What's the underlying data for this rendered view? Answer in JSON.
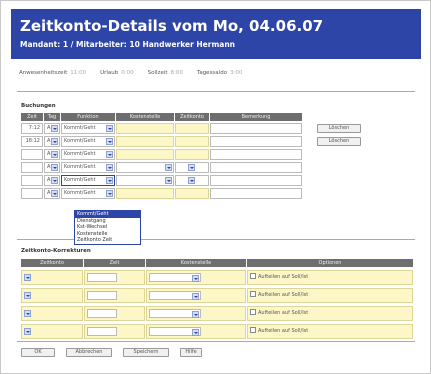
{
  "header": {
    "title": "Zeitkonto-Details vom Mo, 04.06.07",
    "subtitle": "Mandant: 1 / Mitarbeiter: 10 Handwerker Hermann"
  },
  "summary": {
    "items": [
      {
        "label": "Anwesenheitszeit",
        "value": "11:00"
      },
      {
        "label": "Urlaub",
        "value": "0:00"
      },
      {
        "label": "Sollzeit",
        "value": "8:00"
      },
      {
        "label": "Tagessaldo",
        "value": "3:00"
      }
    ]
  },
  "buchungen": {
    "section_label": "Buchungen",
    "columns": [
      "Zeit",
      "Tag",
      "Funktion",
      "Kostenstelle",
      "Zeitkonto",
      "Bemerkung"
    ],
    "rows": [
      {
        "zeit": "7:12",
        "tag": "A",
        "funktion": "Kommt/Geht"
      },
      {
        "zeit": "18:12",
        "tag": "A",
        "funktion": "Kommt/Geht"
      },
      {
        "zeit": "",
        "tag": "A",
        "funktion": "Kommt/Geht"
      },
      {
        "zeit": "",
        "tag": "A",
        "funktion": "Kommt/Geht"
      },
      {
        "zeit": "",
        "tag": "A",
        "funktion": "Kommt/Geht"
      },
      {
        "zeit": "",
        "tag": "A",
        "funktion": "Kommt/Geht"
      }
    ],
    "delete_label": "Löschen",
    "dropdown_options": [
      "Kommt/Geht",
      "Dienstgang",
      "Kst-Wechsel",
      "Kostenstelle",
      "Zeitkonto Zeit"
    ]
  },
  "korrekturen": {
    "section_label": "Zeitkonto-Korrekturen",
    "columns": [
      "Zeitkonto",
      "Zeit",
      "Kostenstelle",
      "Optionen"
    ],
    "option_label": "Aufteilen auf Soll/Ist",
    "row_count": 4
  },
  "footer": {
    "ok": "OK",
    "cancel": "Abbrechen",
    "save": "Speichern",
    "help": "Hilfe"
  }
}
